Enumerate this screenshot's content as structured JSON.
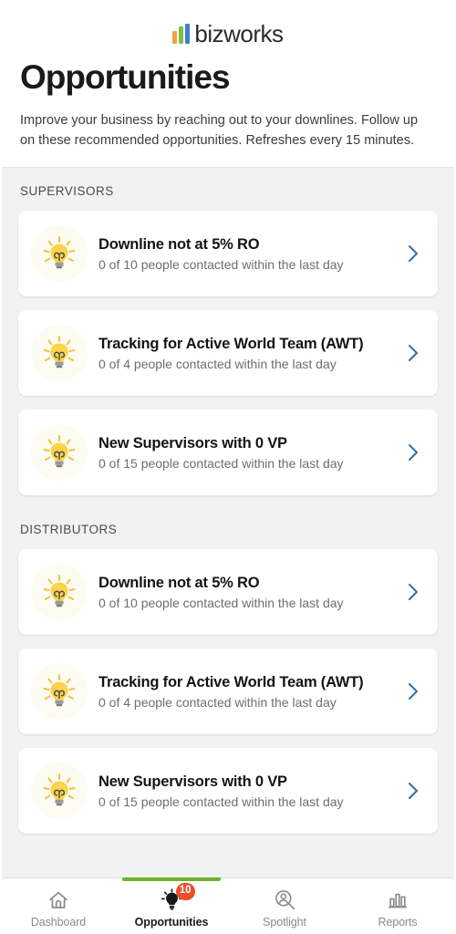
{
  "header": {
    "logo_text": "bizworks",
    "logo_colors": {
      "bar1": "#f2a33c",
      "bar2": "#7cc142",
      "bar3": "#3d7fd1"
    },
    "title": "Opportunities",
    "description": "Improve your business by reaching out to your downlines. Follow up on these recommended opportunities. Refreshes every 15 minutes."
  },
  "sections": [
    {
      "title": "SUPERVISORS",
      "cards": [
        {
          "title": "Downline not at 5% RO",
          "subtitle": "0 of 10 people contacted within the last day"
        },
        {
          "title": "Tracking for Active World Team (AWT)",
          "subtitle": "0 of 4 people contacted within the last day"
        },
        {
          "title": "New Supervisors with 0 VP",
          "subtitle": "0 of 15 people contacted within the last day"
        }
      ]
    },
    {
      "title": "DISTRIBUTORS",
      "cards": [
        {
          "title": "Downline not at 5% RO",
          "subtitle": "0 of 10 people contacted within the last day"
        },
        {
          "title": "Tracking for Active World Team (AWT)",
          "subtitle": "0 of 4 people contacted within the last day"
        },
        {
          "title": "New Supervisors with 0 VP",
          "subtitle": "0 of 15 people contacted within the last day"
        }
      ]
    }
  ],
  "tabbar": {
    "active_color": "#6cb22e",
    "badge_color": "#e8502a",
    "tabs": [
      {
        "label": "Dashboard",
        "icon": "home-icon",
        "active": false,
        "badge": ""
      },
      {
        "label": "Opportunities",
        "icon": "lightbulb-icon",
        "active": true,
        "badge": "10"
      },
      {
        "label": "Spotlight",
        "icon": "person-search-icon",
        "active": false,
        "badge": ""
      },
      {
        "label": "Reports",
        "icon": "bar-chart-icon",
        "active": false,
        "badge": ""
      }
    ]
  },
  "icons": {
    "card": "lightbulb-icon",
    "chevron": "chevron-right-icon"
  }
}
